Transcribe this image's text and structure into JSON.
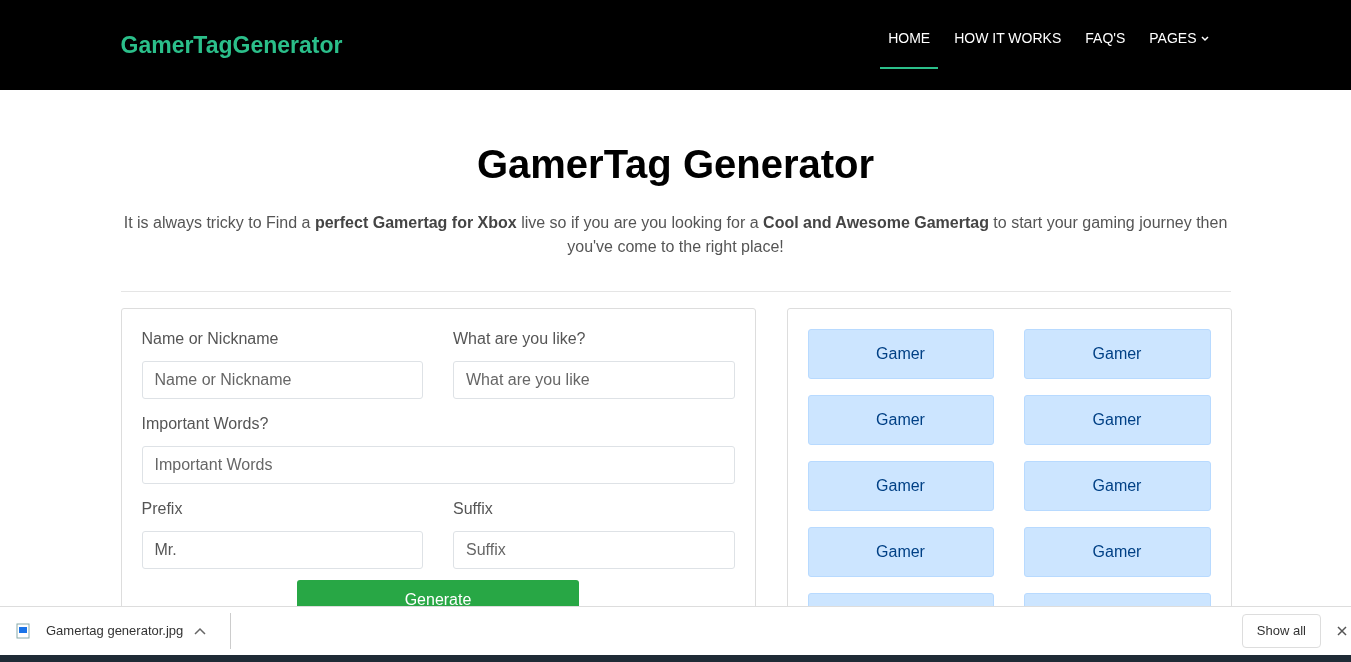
{
  "brand": "GamerTagGenerator",
  "nav": [
    {
      "label": "HOME",
      "selected": true,
      "dropdown": false
    },
    {
      "label": "HOW IT WORKS",
      "selected": false,
      "dropdown": false
    },
    {
      "label": "FAQ'S",
      "selected": false,
      "dropdown": false
    },
    {
      "label": "PAGES",
      "selected": false,
      "dropdown": true
    }
  ],
  "heading": "GamerTag Generator",
  "intro": "It is always tricky to Find a **perfect Gamertag for Xbox** live so if you are you looking for a **Cool and Awesome Gamertag** to start your gaming journey then you've come to the right place!",
  "form": {
    "fields": [
      {
        "label": "Name or Nickname",
        "placeholder": "Name or Nickname",
        "wide": false
      },
      {
        "label": "What are you like?",
        "placeholder": "What are you like",
        "wide": false
      },
      {
        "label": "Important Words?",
        "placeholder": "Important Words",
        "wide": true
      },
      {
        "label": "Prefix",
        "value": "Mr.",
        "wide": false
      },
      {
        "label": "Suffix",
        "placeholder": "Suffix",
        "wide": false
      }
    ],
    "button": "Generate"
  },
  "tiles": [
    {
      "kind": "tag",
      "label": "Gamer"
    },
    {
      "kind": "tag",
      "label": "Gamer"
    },
    {
      "kind": "tag",
      "label": "Gamer"
    },
    {
      "kind": "tag",
      "label": "Gamer"
    },
    {
      "kind": "tag",
      "label": "Gamer"
    },
    {
      "kind": "tag",
      "label": "Gamer"
    },
    {
      "kind": "tag",
      "label": "Gamer"
    },
    {
      "kind": "tag",
      "label": "Gamer"
    },
    {
      "kind": "cut"
    },
    {
      "kind": "cut"
    }
  ],
  "download_bar": {
    "file": "Gamertag generator.jpg",
    "show_all": "Show all"
  }
}
